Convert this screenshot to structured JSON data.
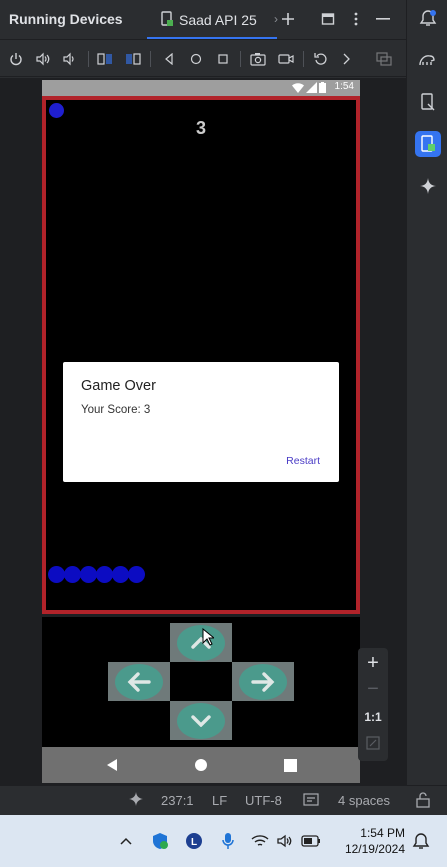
{
  "header": {
    "title": "Running Devices",
    "tab_label": "Saad API 25"
  },
  "device": {
    "status_time": "1:54",
    "game": {
      "score": "3"
    },
    "dialog": {
      "title": "Game Over",
      "message": "Your Score: 3",
      "button": "Restart"
    },
    "zoom": {
      "one_to_one": "1:1"
    }
  },
  "ide_status": {
    "position": "237:1",
    "line_ending": "LF",
    "encoding": "UTF-8",
    "indent": "4 spaces"
  },
  "taskbar": {
    "time": "1:54 PM",
    "date": "12/19/2024"
  },
  "colors": {
    "accent": "#3574f0",
    "game_border": "#b1232a",
    "snake": "#0c0cc2",
    "control_disc": "#4b9a8c"
  }
}
